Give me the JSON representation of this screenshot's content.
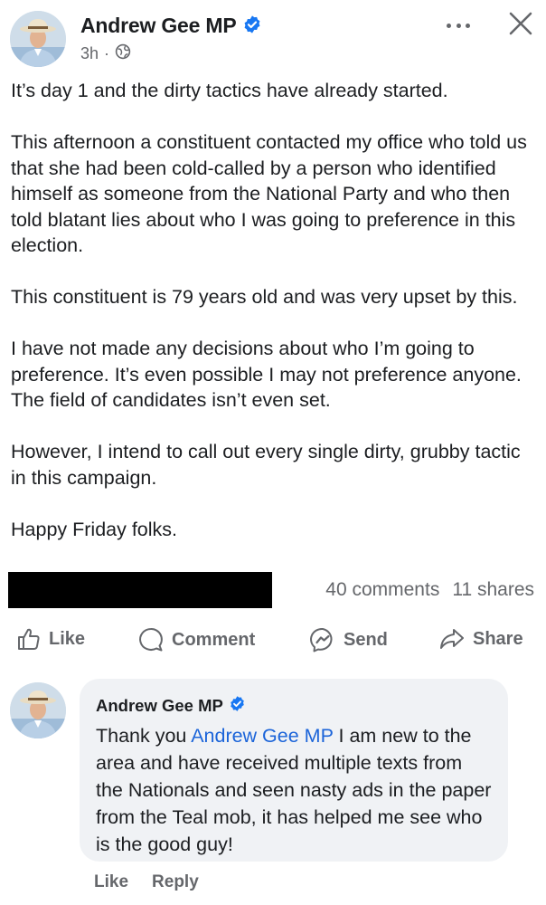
{
  "post": {
    "author": "Andrew Gee MP",
    "time": "3h",
    "time_separator": "·",
    "paragraphs": [
      "It’s day 1 and the dirty tactics have already started.",
      "This afternoon a constituent contacted my office who told us that she had been cold-called by a person who identified himself as someone from the National Party and who then told blatant lies about who I was going to preference in this election.",
      "This constituent is 79 years old and was very upset by this.",
      "I have not made any decisions about who I’m going to preference. It’s even possible I may not preference anyone. The field of candidates isn’t even set.",
      "However, I intend to call out every single dirty, grubby tactic in this campaign.",
      "Happy Friday folks."
    ],
    "comments_count": "40 comments",
    "shares_count": "11 shares"
  },
  "actions": {
    "like": "Like",
    "comment": "Comment",
    "send": "Send",
    "share": "Share"
  },
  "comment": {
    "author": "Andrew Gee MP",
    "text_before": "Thank you ",
    "mention": "Andrew Gee MP",
    "text_after": " I am new to the area and have received multiple texts from the Nationals and seen nasty ads in the paper from the Teal mob, it has helped me see who is the good guy!",
    "like_label": "Like",
    "reply_label": "Reply"
  },
  "icons": {
    "verified": "verified-badge-icon",
    "audience": "globe-icon",
    "more": "more-options-icon",
    "close": "close-icon",
    "like": "thumbs-up-icon",
    "comment": "comment-bubble-icon",
    "send": "messenger-icon",
    "share": "share-arrow-icon"
  },
  "colors": {
    "verified_blue": "#1877f2",
    "mention_blue": "#1b64d9",
    "secondary_text": "#65676b",
    "bubble_bg": "#f0f2f5"
  }
}
